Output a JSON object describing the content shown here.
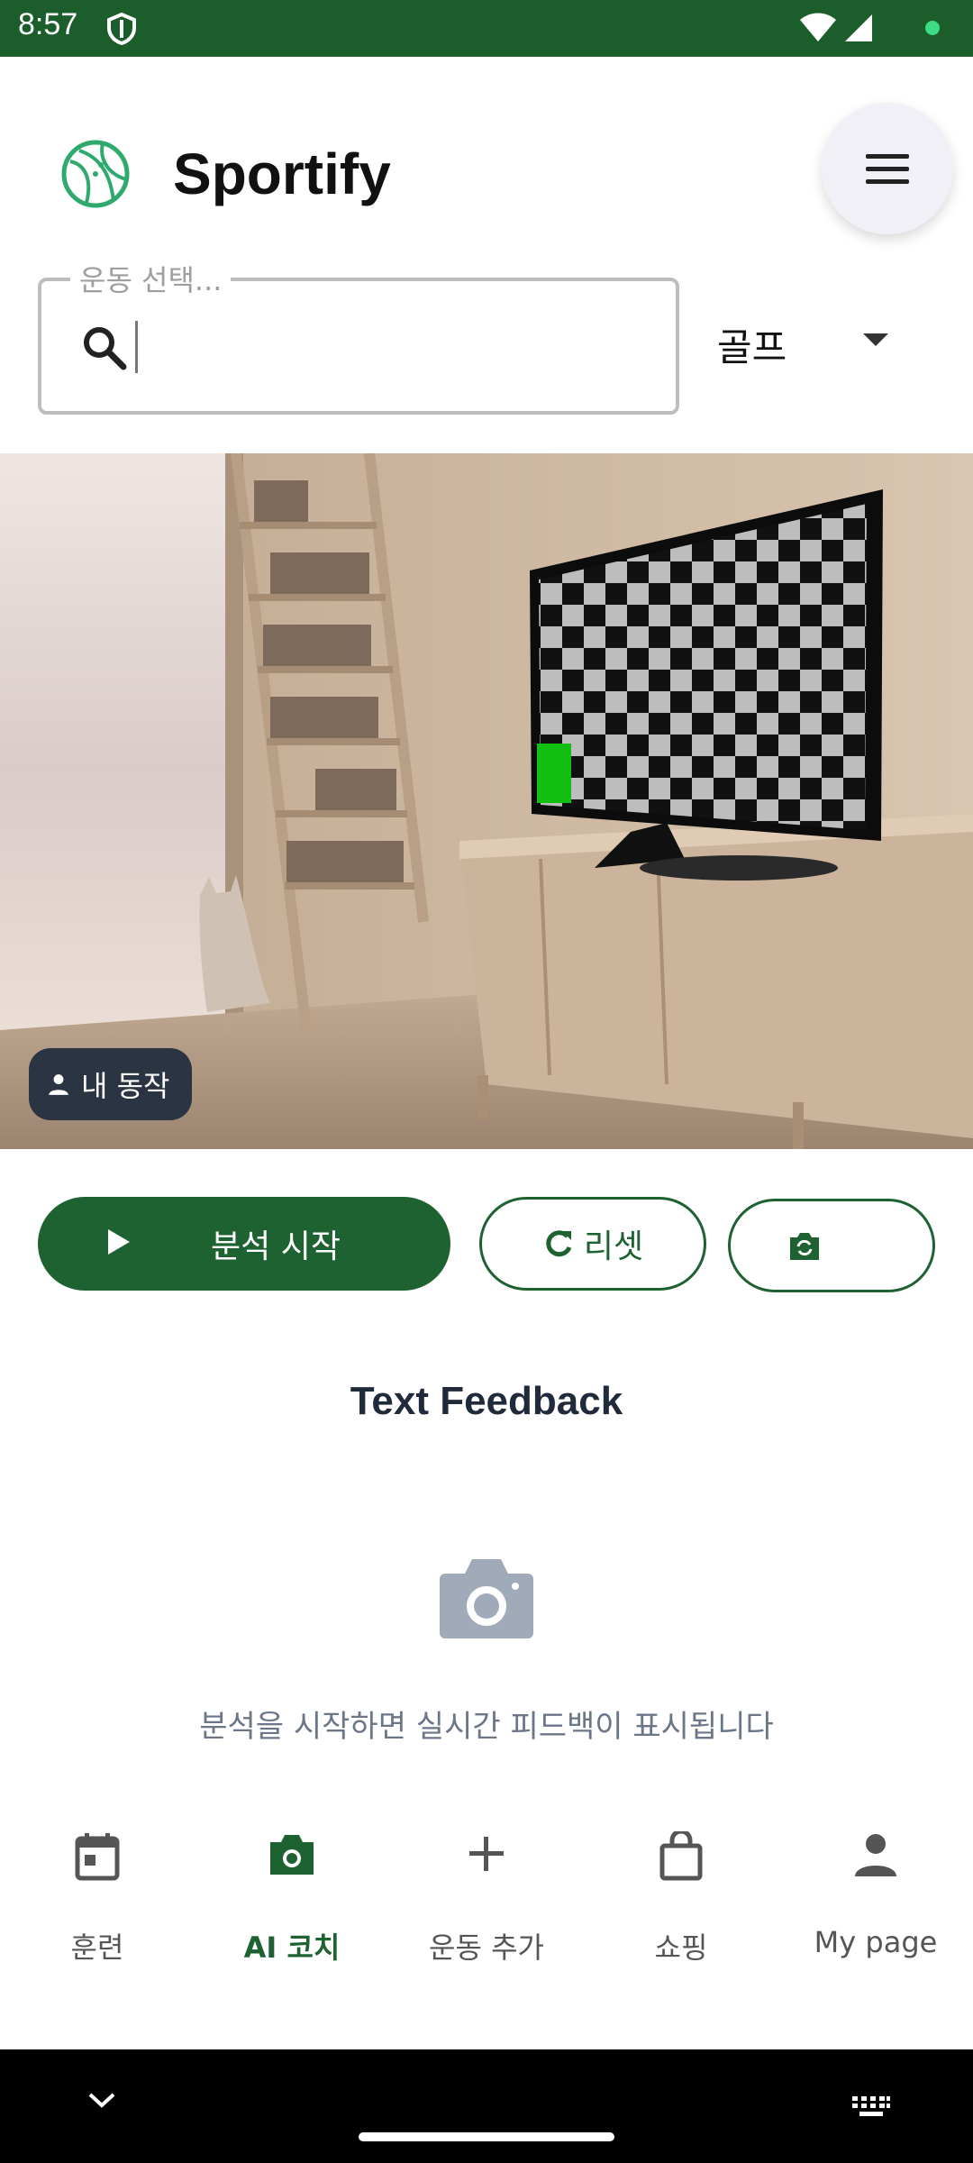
{
  "status_bar": {
    "time": "8:57"
  },
  "header": {
    "app_title": "Sportify"
  },
  "search": {
    "label": "운동 선택...",
    "value": ""
  },
  "sport_select": {
    "value": "골프"
  },
  "camera": {
    "pose_badge": "내 동작"
  },
  "actions": {
    "start_label": "분석 시작",
    "reset_label": "리셋"
  },
  "feedback": {
    "title": "Text Feedback",
    "empty_message": "분석을 시작하면 실시간 피드백이 표시됩니다"
  },
  "bottom_nav": {
    "items": [
      {
        "label": "훈련",
        "icon": "calendar-icon"
      },
      {
        "label": "AI 코치",
        "icon": "camera-icon",
        "active": true
      },
      {
        "label": "운동 추가",
        "icon": "plus-icon"
      },
      {
        "label": "쇼핑",
        "icon": "shopping-bag-icon"
      },
      {
        "label": "My page",
        "icon": "person-icon"
      }
    ]
  },
  "colors": {
    "primary": "#1e6232",
    "status_bar": "#1b5e2b",
    "logo": "#2eaa6e",
    "badge_bg": "#2b3442",
    "muted_text": "#6b7688"
  }
}
